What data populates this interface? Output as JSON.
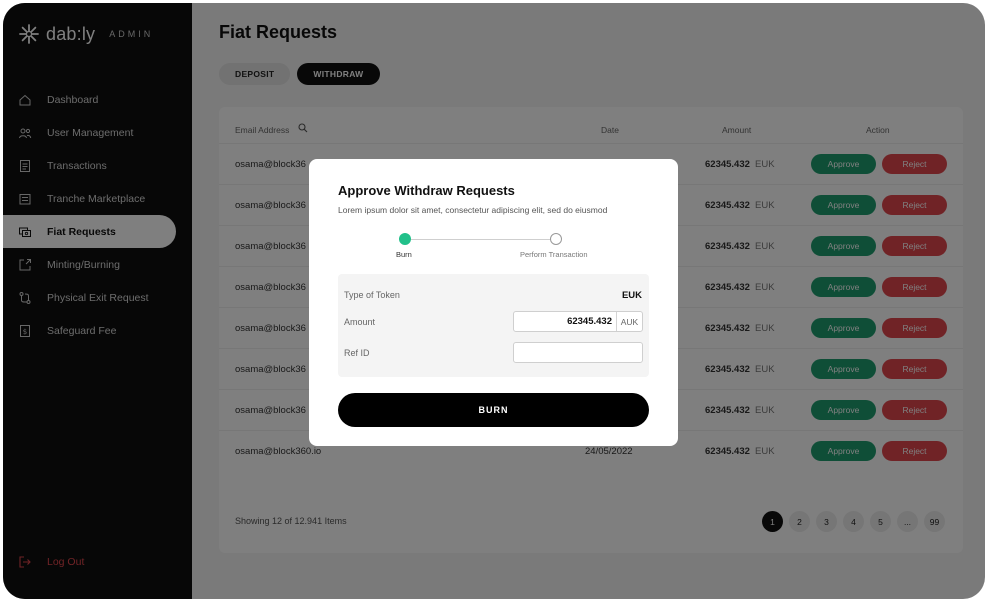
{
  "brand": {
    "name": "dab:ly",
    "tag": "ADMIN"
  },
  "sidebar": {
    "items": [
      {
        "label": "Dashboard",
        "icon": "home-icon"
      },
      {
        "label": "User Management",
        "icon": "users-icon"
      },
      {
        "label": "Transactions",
        "icon": "list-icon"
      },
      {
        "label": "Tranche Marketplace",
        "icon": "marketplace-icon"
      },
      {
        "label": "Fiat Requests",
        "icon": "fiat-icon",
        "active": true
      },
      {
        "label": "Minting/Burning",
        "icon": "minting-icon"
      },
      {
        "label": "Physical Exit Request",
        "icon": "exit-icon"
      },
      {
        "label": "Safeguard Fee",
        "icon": "fee-icon"
      }
    ],
    "logout": "Log Out"
  },
  "page": {
    "title": "Fiat Requests",
    "tabs": [
      {
        "label": "DEPOSIT",
        "active": false
      },
      {
        "label": "WITHDRAW",
        "active": true
      }
    ]
  },
  "table": {
    "headers": {
      "email": "Email Address",
      "date": "Date",
      "amount": "Amount",
      "action": "Action"
    },
    "rows": [
      {
        "email": "osama@block36",
        "date": "",
        "amount": "62345.432",
        "currency": "EUK"
      },
      {
        "email": "osama@block36",
        "date": "",
        "amount": "62345.432",
        "currency": "EUK"
      },
      {
        "email": "osama@block36",
        "date": "",
        "amount": "62345.432",
        "currency": "EUK"
      },
      {
        "email": "osama@block36",
        "date": "",
        "amount": "62345.432",
        "currency": "EUK"
      },
      {
        "email": "osama@block36",
        "date": "",
        "amount": "62345.432",
        "currency": "EUK"
      },
      {
        "email": "osama@block36",
        "date": "",
        "amount": "62345.432",
        "currency": "EUK"
      },
      {
        "email": "osama@block36",
        "date": "",
        "amount": "62345.432",
        "currency": "EUK"
      },
      {
        "email": "osama@block360.io",
        "date": "24/05/2022",
        "amount": "62345.432",
        "currency": "EUK"
      }
    ],
    "approve_label": "Approve",
    "reject_label": "Reject",
    "showing": "Showing 12 of 12.941 Items",
    "pages": [
      "1",
      "2",
      "3",
      "4",
      "5",
      "...",
      "99"
    ],
    "current_page": "1"
  },
  "modal": {
    "title": "Approve Withdraw Requests",
    "subtitle": "Lorem ipsum dolor sit amet, consectetur adipiscing elit, sed do eiusmod",
    "steps": [
      "Burn",
      "Perform Transaction"
    ],
    "fields": {
      "token_label": "Type of Token",
      "token_value": "EUK",
      "amount_label": "Amount",
      "amount_value": "62345.432",
      "amount_unit": "AUK",
      "ref_label": "Ref ID",
      "ref_value": ""
    },
    "burn_label": "BURN"
  },
  "colors": {
    "approve": "#1e9c6e",
    "reject": "#e0474d",
    "step_active": "#22c08a",
    "sidebar_bg": "#0e0e0e"
  }
}
